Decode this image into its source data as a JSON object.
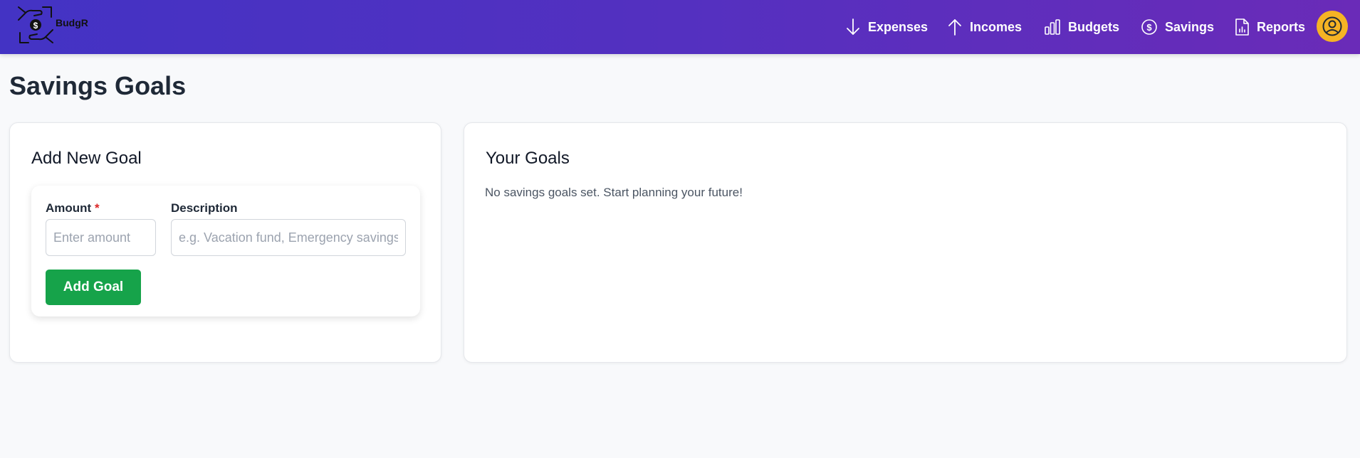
{
  "app": {
    "logo_text": "BudgR"
  },
  "nav": {
    "expenses": "Expenses",
    "incomes": "Incomes",
    "budgets": "Budgets",
    "savings": "Savings",
    "reports": "Reports"
  },
  "page": {
    "title": "Savings Goals"
  },
  "add_goal": {
    "title": "Add New Goal",
    "amount_label": "Amount",
    "required_mark": "*",
    "amount_placeholder": "Enter amount",
    "description_label": "Description",
    "description_placeholder": "e.g. Vacation fund, Emergency savings",
    "submit_label": "Add Goal"
  },
  "goals": {
    "title": "Your Goals",
    "empty_message": "No savings goals set. Start planning your future!"
  },
  "colors": {
    "nav_gradient_start": "#4333c4",
    "nav_gradient_end": "#6a2bb8",
    "primary_button": "#16a34a",
    "avatar_bg": "#f5b324",
    "required": "#dc2626"
  },
  "icons": {
    "logo": "hands-holding-dollar-icon",
    "expenses": "arrow-down-icon",
    "incomes": "arrow-up-icon",
    "budgets": "bar-chart-icon",
    "savings": "dollar-circle-icon",
    "reports": "report-document-icon",
    "avatar": "user-circle-icon"
  }
}
